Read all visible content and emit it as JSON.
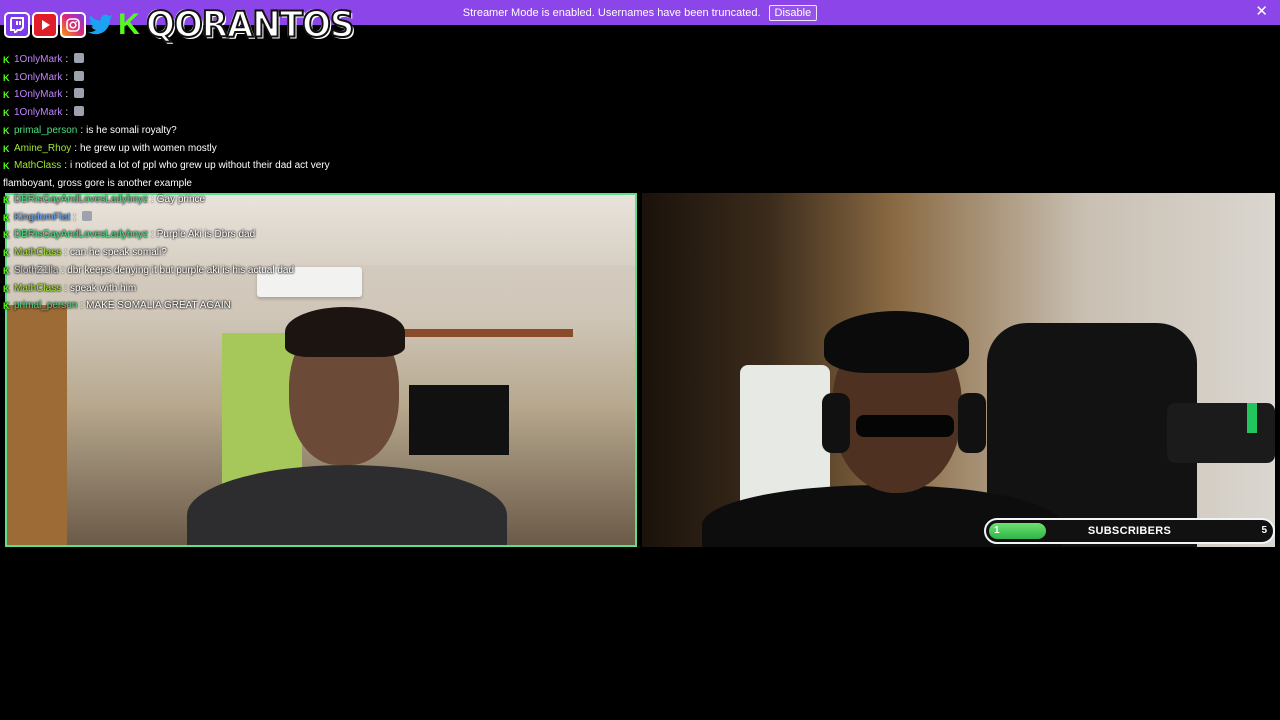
{
  "banner": {
    "message": "Streamer Mode is enabled. Usernames have been truncated.",
    "button": "Disable",
    "close": "✕"
  },
  "socials": {
    "icons": [
      "twitch-icon",
      "youtube-icon",
      "instagram-icon",
      "twitter-icon",
      "kick-icon"
    ],
    "brand": "QORANTOS"
  },
  "chat": [
    {
      "user": "1OnlyMark",
      "sep": ":",
      "text": "",
      "color": "#c084fc"
    },
    {
      "user": "1OnlyMark",
      "sep": ":",
      "text": "",
      "color": "#c084fc"
    },
    {
      "user": "1OnlyMark",
      "sep": ":",
      "text": "",
      "color": "#c084fc"
    },
    {
      "user": "1OnlyMark",
      "sep": ":",
      "text": "",
      "color": "#c084fc"
    },
    {
      "user": "primal_person",
      "sep": ":",
      "text": "is he somali royalty?",
      "color": "#4ade80"
    },
    {
      "user": "Amine_Rhoy",
      "sep": ":",
      "text": "he grew up with women mostly",
      "color": "#a3e635"
    },
    {
      "user": "MathClass",
      "sep": ":",
      "text": "i noticed a lot of ppl who grew up without their dad act very flamboyant, gross gore is another example",
      "color": "#a3e635"
    }
  ],
  "overlay_chat": [
    {
      "user": "DBRisGayAndLovesLadyboyz",
      "sep": ":",
      "text": "Gay prince",
      "color": "#4ade80"
    },
    {
      "user": "KingdomFlat",
      "sep": ":",
      "text": "",
      "color": "#60a5fa"
    },
    {
      "user": "DBRisGayAndLovesLadyboyz",
      "sep": ":",
      "text": "Purple Aki is Dbrs dad",
      "color": "#4ade80"
    },
    {
      "user": "MathClass",
      "sep": ":",
      "text": "can he speak somali?",
      "color": "#a3e635"
    },
    {
      "user": "SlothZ1lla",
      "sep": ":",
      "text": "dbr keeps denying it but purple aki is his actual dad",
      "color": "#d1d5db"
    },
    {
      "user": "MathClass",
      "sep": ":",
      "text": "speak with him",
      "color": "#a3e635"
    },
    {
      "user": "primal_person",
      "sep": ":",
      "text": "MAKE SOMALIA GREAT AGAIN",
      "color": "#4ade80"
    }
  ],
  "subs": {
    "label": "SUBSCRIBERS",
    "current": "1",
    "goal": "5",
    "progress": 0.2
  },
  "colors": {
    "banner": "#8b45e8",
    "cam_border": "#5ee08a",
    "progress": "#2fb34a"
  }
}
